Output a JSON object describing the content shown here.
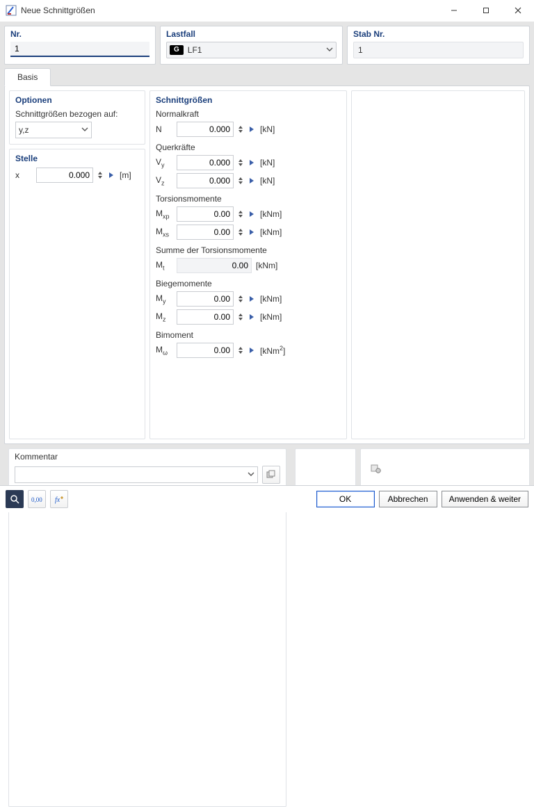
{
  "window": {
    "title": "Neue Schnittgrößen"
  },
  "header": {
    "nr": {
      "label": "Nr.",
      "value": "1"
    },
    "lastfall": {
      "label": "Lastfall",
      "badge": "G",
      "value": "LF1"
    },
    "stab": {
      "label": "Stab Nr.",
      "value": "1"
    }
  },
  "tabs": {
    "basis": "Basis"
  },
  "optionen": {
    "title": "Optionen",
    "refLabel": "Schnittgrößen bezogen auf:",
    "refValue": "y,z"
  },
  "stelle": {
    "title": "Stelle",
    "x": {
      "sym": "x",
      "value": "0.000",
      "unit": "[m]"
    }
  },
  "sg": {
    "title": "Schnittgrößen",
    "normalkraft": {
      "label": "Normalkraft"
    },
    "N": {
      "sym": "N",
      "value": "0.000",
      "unit": "[kN]"
    },
    "querkraefte": {
      "label": "Querkräfte"
    },
    "Vy": {
      "sym": "V",
      "sub": "y",
      "value": "0.000",
      "unit": "[kN]"
    },
    "Vz": {
      "sym": "V",
      "sub": "z",
      "value": "0.000",
      "unit": "[kN]"
    },
    "torsion": {
      "label": "Torsionsmomente"
    },
    "Mxp": {
      "sym": "M",
      "sub": "xp",
      "value": "0.00",
      "unit": "[kNm]"
    },
    "Mxs": {
      "sym": "M",
      "sub": "xs",
      "value": "0.00",
      "unit": "[kNm]"
    },
    "torsionSum": {
      "label": "Summe der Torsionsmomente"
    },
    "Mt": {
      "sym": "M",
      "sub": "t",
      "value": "0.00",
      "unit": "[kNm]"
    },
    "biege": {
      "label": "Biegemomente"
    },
    "My": {
      "sym": "M",
      "sub": "y",
      "value": "0.00",
      "unit": "[kNm]"
    },
    "Mz": {
      "sym": "M",
      "sub": "z",
      "value": "0.00",
      "unit": "[kNm]"
    },
    "bimoment": {
      "label": "Bimoment"
    },
    "Mw": {
      "sym": "M",
      "sub": "ω",
      "value": "0.00",
      "unitHtml": "[kNm<sup>2</sup>]",
      "unit": "[kNm2]"
    }
  },
  "kommentar": {
    "title": "Kommentar"
  },
  "footer": {
    "ok": "OK",
    "cancel": "Abbrechen",
    "applyNext": "Anwenden & weiter"
  }
}
